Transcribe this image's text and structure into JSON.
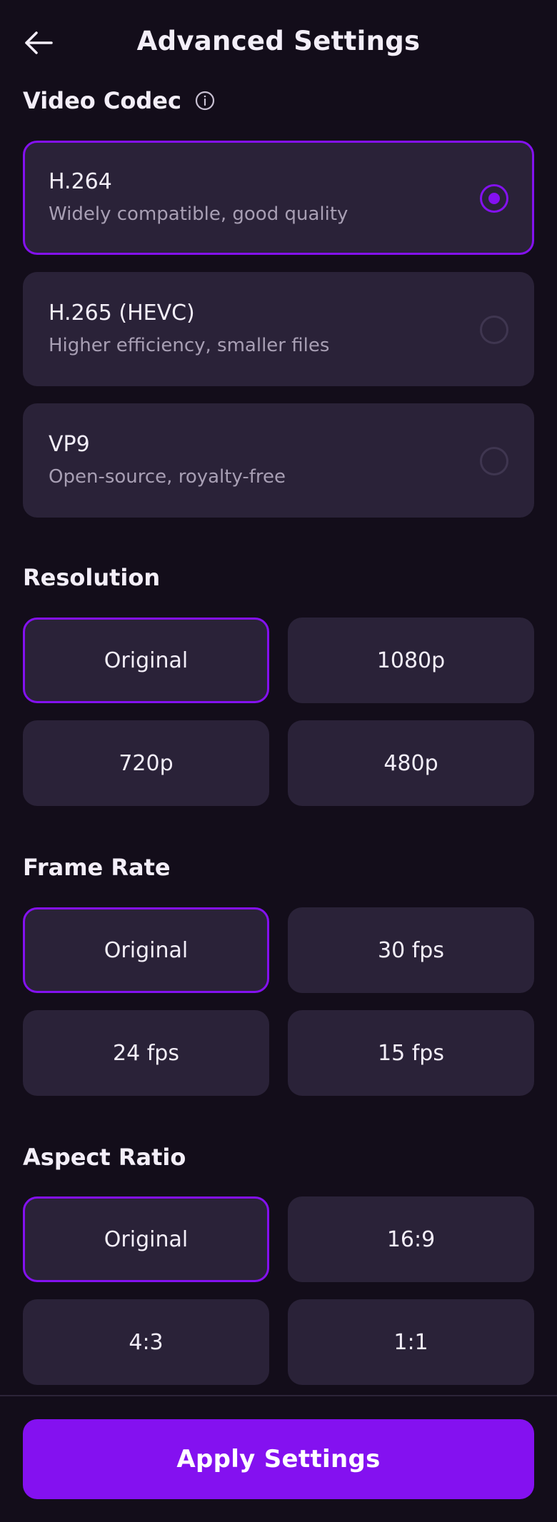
{
  "header": {
    "title": "Advanced Settings",
    "back_icon": "arrow-left-icon"
  },
  "codec": {
    "title": "Video Codec",
    "info_icon": "info-icon",
    "selected": "H.264",
    "options": [
      {
        "name": "H.264",
        "desc": "Widely compatible, good quality",
        "selected": true
      },
      {
        "name": "H.265 (HEVC)",
        "desc": "Higher efficiency, smaller files",
        "selected": false
      },
      {
        "name": "VP9",
        "desc": "Open-source, royalty-free",
        "selected": false
      }
    ]
  },
  "resolution": {
    "title": "Resolution",
    "selected": "Original",
    "options": [
      "Original",
      "1080p",
      "720p",
      "480p"
    ]
  },
  "frame_rate": {
    "title": "Frame Rate",
    "selected": "Original",
    "options": [
      "Original",
      "30 fps",
      "24 fps",
      "15 fps"
    ]
  },
  "aspect_ratio": {
    "title": "Aspect Ratio",
    "selected": "Original",
    "options": [
      "Original",
      "16:9",
      "4:3",
      "1:1"
    ]
  },
  "footer": {
    "apply_label": "Apply Settings"
  },
  "colors": {
    "background": "#130d1a",
    "card": "#2a2238",
    "accent": "#8411f0",
    "text": "#f3eef8",
    "muted_text": "#a89fb4"
  }
}
